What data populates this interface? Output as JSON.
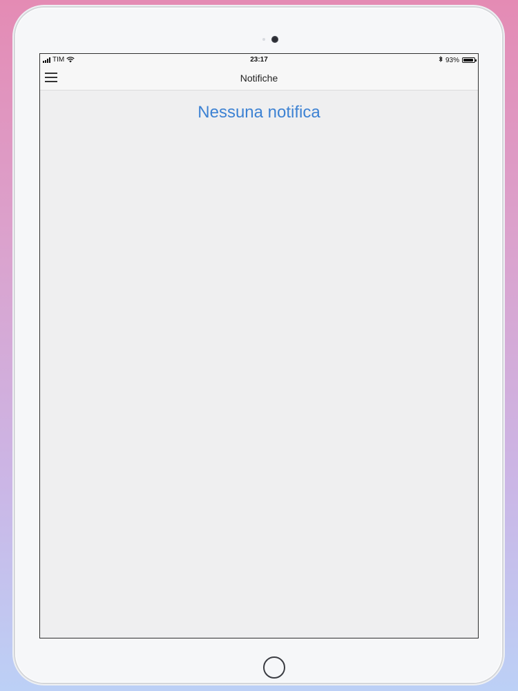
{
  "status_bar": {
    "carrier": "TIM",
    "time": "23:17",
    "battery_percent": "93%",
    "battery_level": 0.93,
    "icons": [
      "signal-icon",
      "wifi-icon",
      "bluetooth-icon",
      "battery-icon"
    ]
  },
  "nav": {
    "title": "Notifiche",
    "menu_icon": "hamburger-menu-icon"
  },
  "content": {
    "empty_message": "Nessuna notifica"
  },
  "colors": {
    "accent": "#3d82d3",
    "screen_background": "#efeff0",
    "bar_background": "#f7f7f7"
  }
}
